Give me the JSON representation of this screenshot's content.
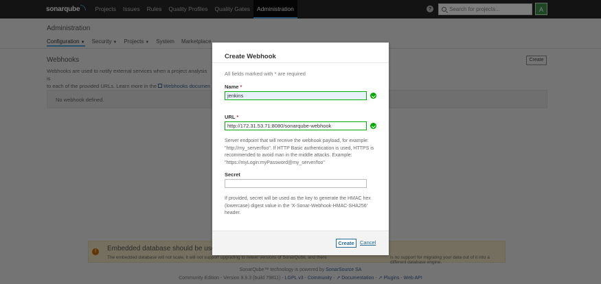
{
  "topnav": {
    "logo": "sonarqube",
    "links": [
      "Projects",
      "Issues",
      "Rules",
      "Quality Profiles",
      "Quality Gates",
      "Administration"
    ],
    "active": "Administration",
    "help": "?",
    "search_placeholder": "Search for projects...",
    "avatar": "A"
  },
  "admin": {
    "title": "Administration",
    "subnav": [
      "Configuration",
      "Security",
      "Projects",
      "System",
      "Marketplace"
    ]
  },
  "page": {
    "title": "Webhooks",
    "create_label": "Create",
    "desc_line1": "Webhooks are used to notify external services when a project analysis is",
    "desc_line2_a": "to each of the provided URLs. Learn more in the",
    "desc_link": "Webhooks documen",
    "empty": "No webhook defined."
  },
  "warning": {
    "title": "Embedded database should be used f",
    "body_a": "The embedded database will not scale, it will not support upgrading to newer versions of SonarQube, and there",
    "body_b": "is no support for migrating your data out of it into a different database engine."
  },
  "footer": {
    "line1_a": "SonarQube™ technology is powered by",
    "line1_link": "SonarSource SA",
    "edition": "Community Edition",
    "version": "Version 9.9.3 (build 79811)",
    "license": "LGPL v3",
    "community": "Community",
    "docs": "Documentation",
    "plugins": "Plugins",
    "webapi": "Web API"
  },
  "modal": {
    "title": "Create Webhook",
    "required_note": "All fields marked with * are required",
    "name_label": "Name",
    "name_value": "jenkins",
    "url_label": "URL",
    "url_value": "http://172.31.53.71:8080/sonarqube-webhook",
    "url_help": "Server endpoint that will receive the webhook payload, for example: \"http://my_server/foo\". If HTTP Basic authentication is used, HTTPS is recommended to avoid man in the middle attacks. Example: \"https://myLogin:myPassword@my_server/foo\"",
    "secret_label": "Secret",
    "secret_value": "",
    "secret_help": "If provided, secret will be used as the key to generate the HMAC hex (lowercase) digest value in the 'X-Sonar-Webhook-HMAC-SHA256' header.",
    "create_button": "Create",
    "cancel_button": "Cancel"
  },
  "colors": {
    "topnav_bg": "#262626",
    "accent": "#4b9fd5",
    "valid": "#00aa00",
    "link": "#236a97"
  }
}
